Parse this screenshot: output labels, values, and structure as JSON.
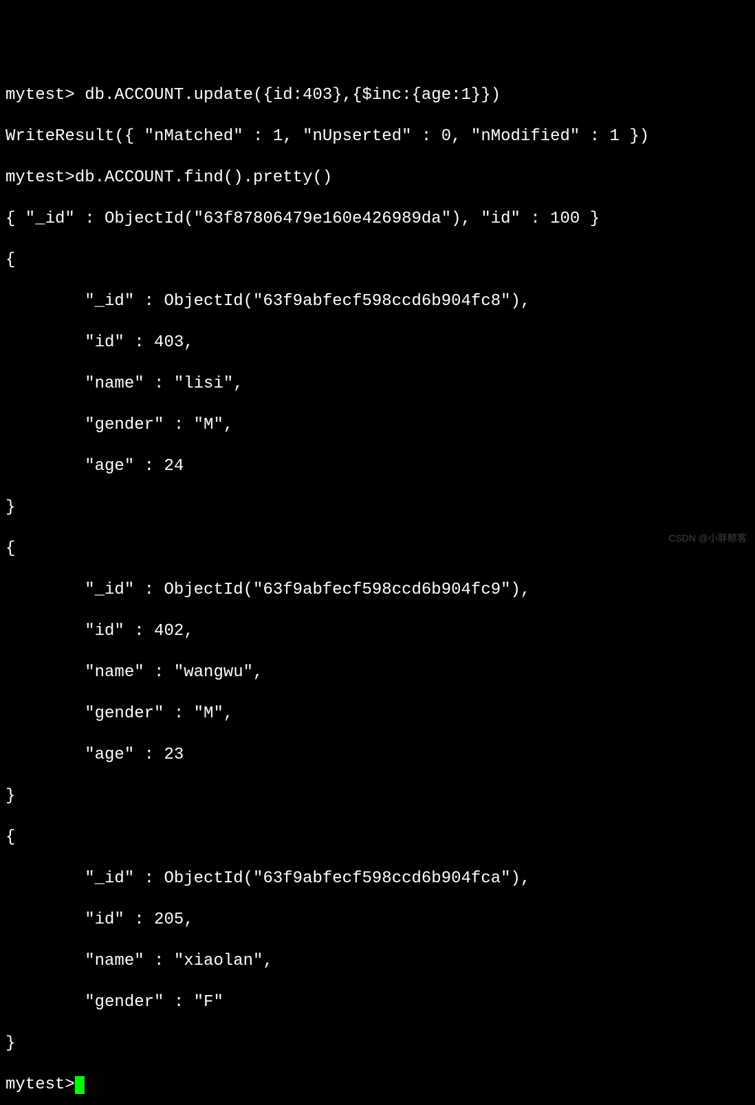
{
  "lines": {
    "l0": "mytest> db.ACCOUNT.update({id:403},{$inc:{age:1}})",
    "l1": "WriteResult({ \"nMatched\" : 1, \"nUpserted\" : 0, \"nModified\" : 1 })",
    "l2": "mytest>db.ACCOUNT.find().pretty()",
    "l3": "{ \"_id\" : ObjectId(\"63f87806479e160e426989da\"), \"id\" : 100 }",
    "l4": "{",
    "l5": "        \"_id\" : ObjectId(\"63f9abfecf598ccd6b904fc8\"),",
    "l6": "        \"id\" : 403,",
    "l7": "        \"name\" : \"lisi\",",
    "l8": "        \"gender\" : \"M\",",
    "l9": "        \"age\" : 24",
    "l10": "}",
    "l11": "{",
    "l12": "        \"_id\" : ObjectId(\"63f9abfecf598ccd6b904fc9\"),",
    "l13": "        \"id\" : 402,",
    "l14": "        \"name\" : \"wangwu\",",
    "l15": "        \"gender\" : \"M\",",
    "l16": "        \"age\" : 23",
    "l17": "}",
    "l18": "{",
    "l19": "        \"_id\" : ObjectId(\"63f9abfecf598ccd6b904fca\"),",
    "l20": "        \"id\" : 205,",
    "l21": "        \"name\" : \"xiaolan\",",
    "l22": "        \"gender\" : \"F\"",
    "l23": "}",
    "prompt": "mytest>"
  },
  "watermark": "CSDN @小胖鲸客"
}
